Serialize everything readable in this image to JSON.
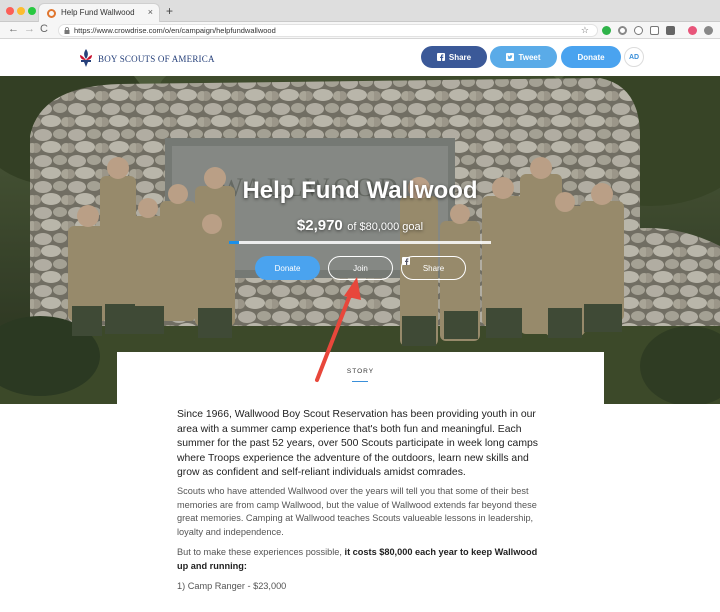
{
  "browser": {
    "tab_title": "Help Fund Wallwood",
    "url": "https://www.crowdrise.com/o/en/campaign/helpfundwallwood",
    "new_tab_glyph": "+",
    "tab_close_glyph": "×",
    "back_glyph": "←",
    "forward_glyph": "→",
    "reload_glyph": "C",
    "star_glyph": "☆"
  },
  "header": {
    "logo_text": "BOY SCOUTS OF AMERICA",
    "share_label": "Share",
    "tweet_label": "Tweet",
    "donate_label": "Donate",
    "avatar_initials": "AD"
  },
  "hero": {
    "title": "Help Fund Wallwood",
    "amount_raised": "$2,970",
    "goal_text": "of $80,000 goal",
    "progress_fraction": 0.037,
    "donate_label": "Donate",
    "join_label": "Join",
    "share_label": "Share"
  },
  "story": {
    "tab_label": "STORY",
    "paragraph_1": "Since 1966, Wallwood Boy Scout Reservation has been providing youth in our area with a summer camp experience that's both fun and meaningful. Each summer for the past 52 years, over 500 Scouts participate in week long camps where Troops experience the adventure of the outdoors, learn new skills and grow as confident and self-reliant individuals amidst comrades.",
    "paragraph_2": "Scouts who have attended Wallwood over the years will tell you that some of their best memories are from camp Wallwood, but the value of Wallwood extends far beyond these great memories. Camping at Wallwood teaches Scouts valueable lessons in leadership, loyalty and independence.",
    "paragraph_3_lead": "But to make these experiences possible, ",
    "paragraph_3_bold": "it costs $80,000 each year to keep Wallwood up and running:",
    "list_item_1": "1) Camp Ranger - $23,000"
  },
  "colors": {
    "facebook_blue": "#3b5998",
    "twitter_blue": "#5aabe8",
    "donate_blue": "#4aa3ef",
    "accent_blue": "#3a8fd9",
    "annotation_red": "#e8473b"
  }
}
